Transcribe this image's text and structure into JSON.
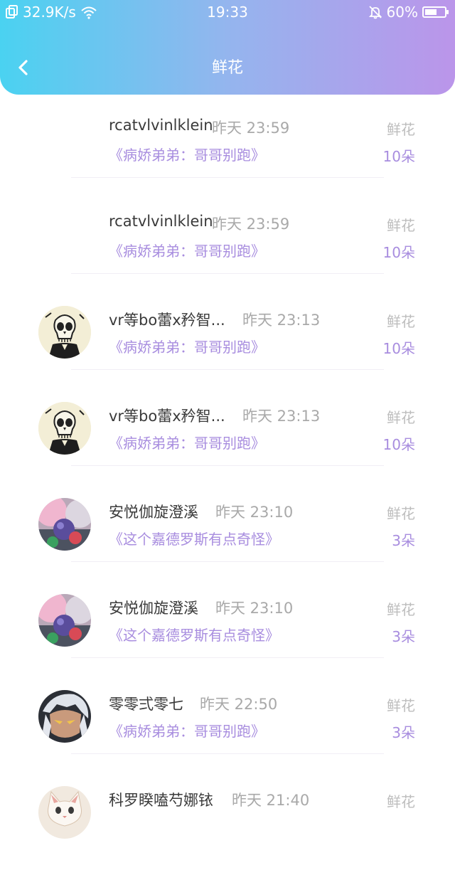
{
  "status_bar": {
    "speed": "32.9K/s",
    "time": "19:33",
    "battery": "60%",
    "battery_level": 0.6
  },
  "nav": {
    "title": "鲜花"
  },
  "records": [
    {
      "name": "rcatvlvinlklein",
      "time": "昨天 23:59",
      "type": "鲜花",
      "book": "《病娇弟弟：哥哥别跑》",
      "count": "10朵",
      "avatar": "none"
    },
    {
      "name": "rcatvlvinlklein",
      "time": "昨天 23:59",
      "type": "鲜花",
      "book": "《病娇弟弟：哥哥别跑》",
      "count": "10朵",
      "avatar": "none"
    },
    {
      "name": "vr等bo蕾x矜智...",
      "time": "昨天 23:13",
      "type": "鲜花",
      "book": "《病娇弟弟：哥哥别跑》",
      "count": "10朵",
      "avatar": "skull"
    },
    {
      "name": "vr等bo蕾x矜智...",
      "time": "昨天 23:13",
      "type": "鲜花",
      "book": "《病娇弟弟：哥哥别跑》",
      "count": "10朵",
      "avatar": "skull"
    },
    {
      "name": "安悦伽旋澄溪",
      "time": "昨天 23:10",
      "type": "鲜花",
      "book": "《这个嘉德罗斯有点奇怪》",
      "count": "3朵",
      "avatar": "orb"
    },
    {
      "name": "安悦伽旋澄溪",
      "time": "昨天 23:10",
      "type": "鲜花",
      "book": "《这个嘉德罗斯有点奇怪》",
      "count": "3朵",
      "avatar": "orb"
    },
    {
      "name": "零零弍零七",
      "time": "昨天 22:50",
      "type": "鲜花",
      "book": "《病娇弟弟：哥哥别跑》",
      "count": "3朵",
      "avatar": "anime"
    },
    {
      "name": "科罗睽嗑芍娜铱",
      "time": "昨天 21:40",
      "type": "鲜花",
      "book": "",
      "count": "",
      "avatar": "cat"
    }
  ]
}
